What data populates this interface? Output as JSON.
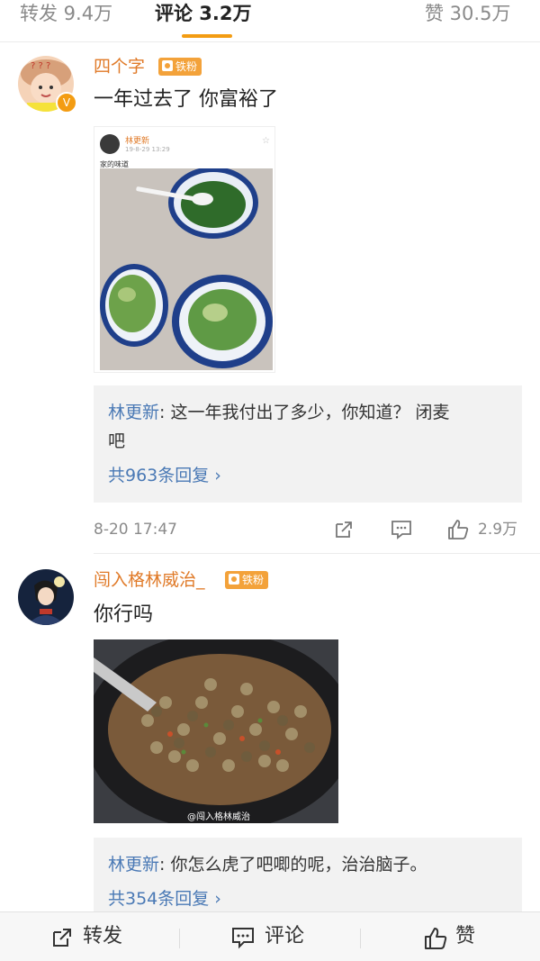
{
  "tabs": [
    {
      "label": "转发 9.4万"
    },
    {
      "label": "评论 3.2万"
    },
    {
      "label": "赞 30.5万"
    }
  ],
  "comments": [
    {
      "username": "四个字",
      "badge": "铁粉",
      "text": "一年过去了  你富裕了",
      "embedded_post": {
        "author": "林更新",
        "time": "19-8-29 13:29",
        "caption": "家的味道"
      },
      "reply": {
        "user": "林更新",
        "text": ": 这一年我付出了多少，你知道？ 闭麦",
        "text_wrap": "吧",
        "more": "共963条回复 ›"
      },
      "time": "8-20 17:47",
      "likes": "2.9万"
    },
    {
      "username": "闯入格林威治_",
      "badge": "铁粉",
      "text": "你行吗",
      "image_watermark": "@闯入格林威治",
      "reply": {
        "user": "林更新",
        "text": ": 你怎么虎了吧唧的呢，治治脑子。",
        "more": "共354条回复 ›"
      }
    }
  ],
  "bottom_bar": {
    "repost_label": "转发",
    "comment_label": "评论",
    "like_label": "赞"
  },
  "colors": {
    "accent": "#f39c12",
    "username": "#e07a28",
    "link": "#4a79b5"
  }
}
